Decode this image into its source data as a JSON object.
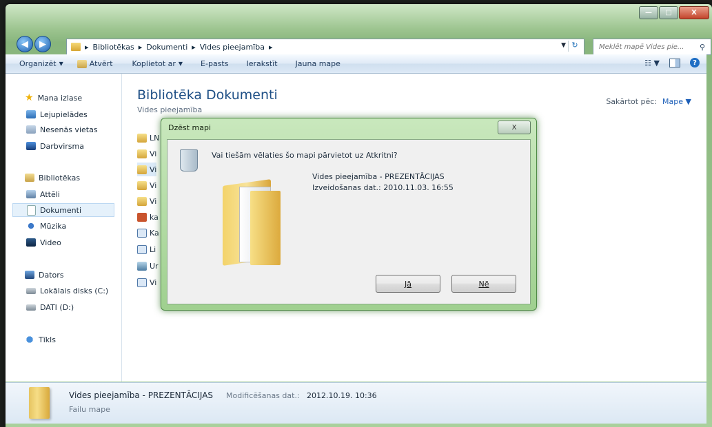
{
  "window": {
    "caption_buttons": [
      "—",
      "□",
      "X"
    ]
  },
  "address": {
    "crumbs": [
      "Bibliotēkas",
      "▸",
      "Dokumenti",
      "▸",
      "Vides pieejamība",
      "▸"
    ],
    "search_placeholder": "Meklēt mapē Vides pie..."
  },
  "toolbar": {
    "organize": "Organizēt",
    "open": "Atvērt",
    "share": "Koplietot ar",
    "email": "E-pasts",
    "burn": "Ierakstīt",
    "new_folder": "Jauna mape"
  },
  "nav": {
    "favorites": "Mana izlase",
    "downloads": "Lejupielādes",
    "recent": "Nesenās vietas",
    "desktop": "Darbvirsma",
    "libraries": "Bibliotēkas",
    "pictures": "Attēli",
    "documents": "Dokumenti",
    "music": "Mūzika",
    "video": "Video",
    "computer": "Dators",
    "local_disk": "Lokālais disks (C:)",
    "data_disk": "DATI (D:)",
    "network": "Tīkls"
  },
  "content": {
    "title": "Bibliotēka Dokumenti",
    "subtitle": "Vides pieejamība",
    "arrange_label": "Sakārtot pēc:",
    "arrange_value": "Mape",
    "files": [
      "LN",
      "Vi",
      "Vi",
      "Vi",
      "Vi",
      "ka",
      "Ka",
      "Li",
      "Ur",
      "Vi"
    ]
  },
  "details": {
    "name": "Vides pieejamība - PREZENTĀCIJAS",
    "modified_label": "Modificēšanas dat.:",
    "modified_value": "2012.10.19. 10:36",
    "type": "Failu mape"
  },
  "dialog": {
    "title": "Dzēst mapi",
    "close": "X",
    "question": "Vai tiešām vēlaties šo mapi pārvietot uz Atkritni?",
    "item_name": "Vides pieejamība - PREZENTĀCIJAS",
    "item_date": "Izveidošanas dat.: 2010.11.03. 16:55",
    "yes": "Jā",
    "no": "Nē"
  }
}
